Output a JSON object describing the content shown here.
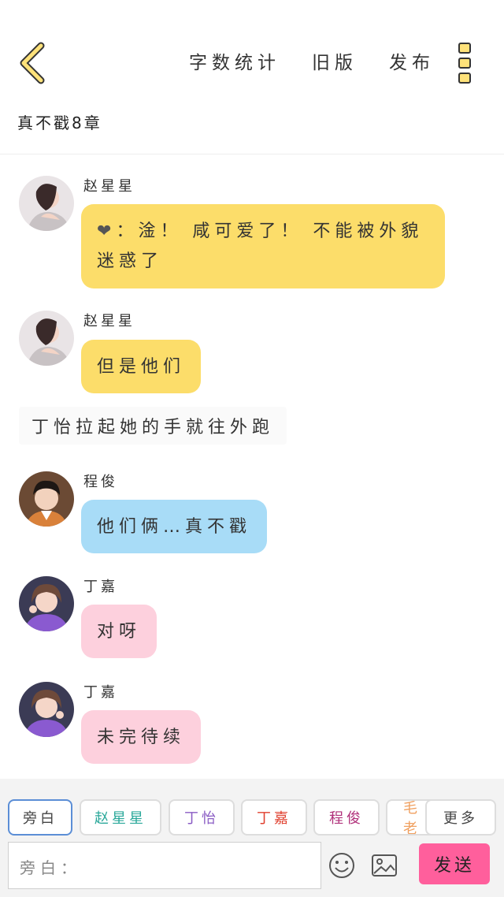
{
  "header": {
    "actions": {
      "word_count": "字数统计",
      "old_version": "旧版",
      "publish": "发布"
    },
    "chapter_title": "真不戳8章"
  },
  "messages": [
    {
      "speaker": "赵星星",
      "prefix": "❤",
      "text": "：淦！ 咸可爱了！ 不能被外貌迷惑了"
    },
    {
      "speaker": "赵星星",
      "text": "但是他们"
    },
    {
      "narration": "丁怡拉起她的手就往外跑"
    },
    {
      "speaker": "程俊",
      "text": "他们俩…真不戳"
    },
    {
      "speaker": "丁嘉",
      "text": "对呀"
    },
    {
      "speaker": "丁嘉",
      "text": "未完待续"
    }
  ],
  "chips": [
    {
      "label": "旁白",
      "color": "#444444"
    },
    {
      "label": "赵星星",
      "color": "#2aa89a"
    },
    {
      "label": "丁怡",
      "color": "#8a5cc4"
    },
    {
      "label": "丁嘉",
      "color": "#e0402f"
    },
    {
      "label": "程俊",
      "color": "#b0307a"
    },
    {
      "label": "毛老",
      "color": "#f0a060"
    },
    {
      "label": "更多",
      "color": "#444444"
    }
  ],
  "composer": {
    "placeholder": "旁白：",
    "send_label": "发送"
  },
  "colors": {
    "accent_yellow": "#fcdd6a",
    "blue_bubble": "#a8dcf7",
    "pink_bubble": "#fdd0dd",
    "send": "#ff5f9c"
  }
}
